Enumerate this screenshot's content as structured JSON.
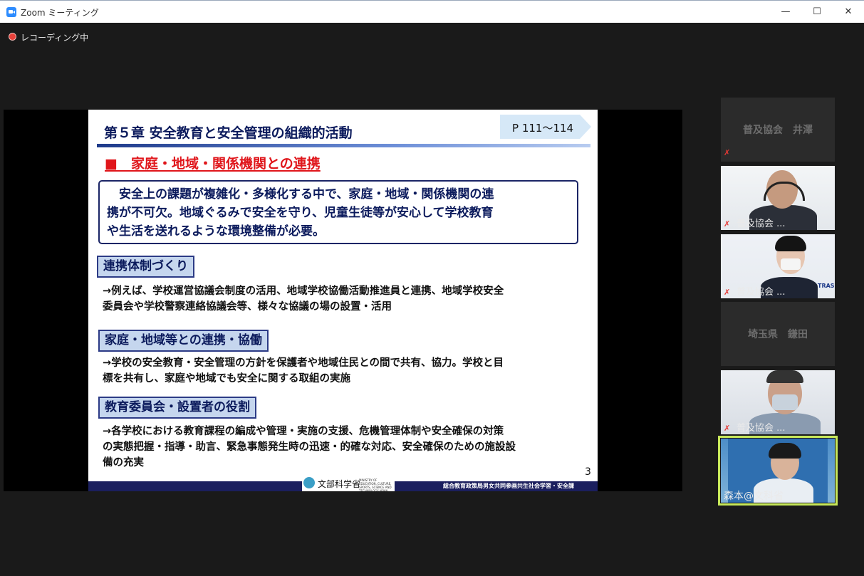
{
  "window": {
    "title": "Zoom ミーティング",
    "minimize_icon": "minimize-icon",
    "maximize_icon": "maximize-icon",
    "close_icon": "close-icon"
  },
  "recording": {
    "label": "レコーディング中",
    "color": "#e8413a"
  },
  "slide": {
    "heading": "第５章 安全教育と安全管理の組織的活動",
    "page_ref": "P 111～114",
    "sub_heading": "■　家庭・地域・関係機関との連携",
    "summary_lines": [
      "　安全上の課題が複雑化・多様化する中で、家庭・地域・関係機関の連",
      "携が不可欠。地域ぐるみで安全を守り、児童生徒等が安心して学校教育",
      "や生活を送れるような環境整備が必要。"
    ],
    "sections": [
      {
        "label": "連携体制づくり",
        "lines": [
          "→例えば、学校運営協議会制度の活用、地域学校協働活動推進員と連携、地域学校安全",
          "委員会や学校警察連絡協議会等、様々な協議の場の設置・活用"
        ]
      },
      {
        "label": "家庭・地域等との連携・協働",
        "lines": [
          "→学校の安全教育・安全管理の方針を保護者や地域住民との間で共有、協力。学校と目",
          "標を共有し、家庭や地域でも安全に関する取組の実施"
        ]
      },
      {
        "label": "教育委員会・設置者の役割",
        "lines": [
          "→各学校における教育課程の編成や管理・実施の支援、危機管理体制や安全確保の対策",
          "の実態把握・指導・助言、緊急事態発生時の迅速・的確な対応、安全確保のための施設設",
          "備の充実"
        ]
      }
    ],
    "page_number": "3",
    "logo_text": "文部科学省",
    "logo_english": "MINISTRY OF EDUCATION, CULTURE, SPORTS, SCIENCE AND TECHNOLOGY-JAPAN",
    "footer_text": "総合教育政策局男女共同参画共生社会学習・安全課"
  },
  "participants": [
    {
      "name": "普及協会　井澤",
      "video": false,
      "muted": true
    },
    {
      "name": "普及協会 ...",
      "video": true,
      "muted": true
    },
    {
      "name": "普及協会 ...",
      "video": true,
      "muted": true
    },
    {
      "name": "埼玉県　鎌田",
      "video": false,
      "muted": false
    },
    {
      "name": "普及協会 ...",
      "video": true,
      "muted": true
    },
    {
      "name": "森本@文科省",
      "video": true,
      "muted": false,
      "active": true
    }
  ],
  "colors": {
    "accent": "#2d8cff",
    "active_speaker": "#c7e85a",
    "slide_heading": "#0b1a5c",
    "slide_subheading": "#e0161b"
  }
}
